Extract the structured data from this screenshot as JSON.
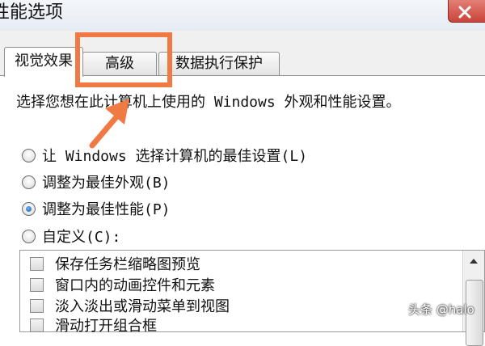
{
  "window": {
    "title": "性能选项",
    "close_icon": "close-icon",
    "close_color": "#c9443a"
  },
  "tabs": [
    {
      "label": "视觉效果",
      "active": true
    },
    {
      "label": "高级",
      "active": false
    },
    {
      "label": "数据执行保护",
      "active": false
    }
  ],
  "panel": {
    "description": "选择您想在此计算机上使用的 Windows 外观和性能设置。",
    "radio_options": [
      {
        "label": "让 Windows 选择计算机的最佳设置(L)",
        "checked": false
      },
      {
        "label": "调整为最佳外观(B)",
        "checked": false
      },
      {
        "label": "调整为最佳性能(P)",
        "checked": true
      },
      {
        "label": "自定义(C):",
        "checked": false
      }
    ],
    "effects": [
      {
        "label": "保存任务栏缩略图预览",
        "checked": false
      },
      {
        "label": "窗口内的动画控件和元素",
        "checked": false
      },
      {
        "label": "淡入淡出或滑动菜单到视图",
        "checked": false
      },
      {
        "label": "滑动打开组合框",
        "checked": false
      }
    ]
  },
  "annotation": {
    "color": "#f07a44",
    "target": "高级"
  },
  "watermark": "头条 @halo"
}
